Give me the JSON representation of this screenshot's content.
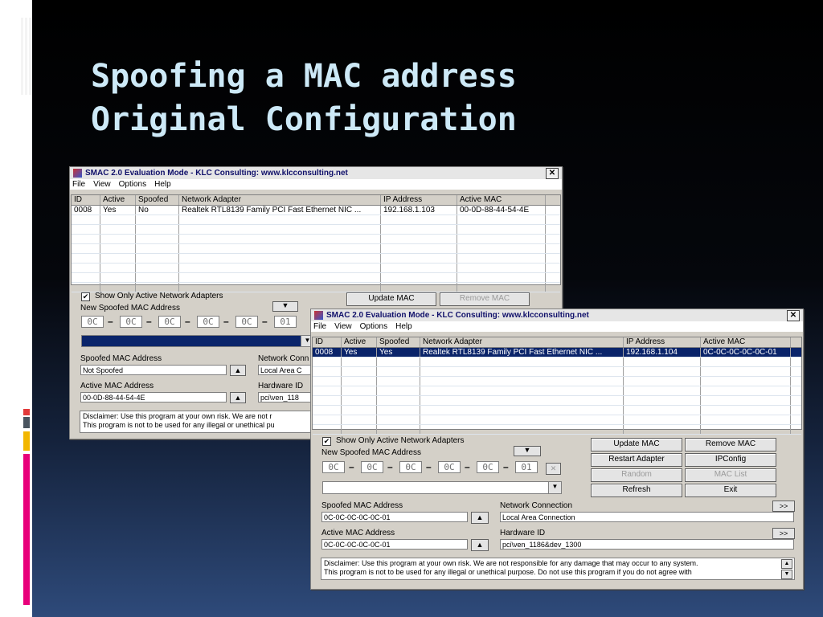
{
  "slide": {
    "title_line1": "Spoofing a MAC address",
    "title_line2": "Original Configuration",
    "colors": {
      "title": "#cde9f7",
      "accent_red": "#e23a3a",
      "accent_gray": "#4a5560",
      "accent_orange": "#f2b600",
      "accent_pink": "#e8007a"
    }
  },
  "window_back": {
    "title": "SMAC 2.0  Evaluation Mode  -  KLC Consulting:  www.klcconsulting.net",
    "menu": [
      "File",
      "View",
      "Options",
      "Help"
    ],
    "columns": [
      "ID",
      "Active",
      "Spoofed",
      "Network Adapter",
      "IP Address",
      "Active MAC"
    ],
    "rows": [
      [
        "0008",
        "Yes",
        "No",
        "Realtek RTL8139 Family PCI Fast Ethernet NIC ...",
        "192.168.1.103",
        "00-0D-88-44-54-4E"
      ]
    ],
    "checkbox_label": "Show Only Active Network Adapters",
    "checkbox_mark": "✔",
    "new_mac_label": "New Spoofed MAC Address",
    "octets": [
      "0C",
      "0C",
      "0C",
      "0C",
      "0C",
      "01"
    ],
    "update_mac": "Update MAC",
    "remove_mac": "Remove MAC",
    "spoofed_label": "Spoofed MAC Address",
    "spoofed_value": "Not Spoofed",
    "active_label": "Active MAC Address",
    "active_value": "00-0D-88-44-54-4E",
    "netconn_label": "Network Conn",
    "netconn_value": "Local Area C",
    "hwid_label": "Hardware ID",
    "hwid_value": "pci\\ven_118",
    "disclaimer_line1": "Disclaimer: Use this program at your own risk.  We are not r",
    "disclaimer_line2": "This program is not to be used for any illegal or unethical pu"
  },
  "window_front": {
    "title": "SMAC 2.0  Evaluation Mode  -  KLC Consulting:  www.klcconsulting.net",
    "menu": [
      "File",
      "View",
      "Options",
      "Help"
    ],
    "columns": [
      "ID",
      "Active",
      "Spoofed",
      "Network Adapter",
      "IP Address",
      "Active MAC"
    ],
    "rows": [
      [
        "0008",
        "Yes",
        "Yes",
        "Realtek RTL8139 Family PCI Fast Ethernet NIC ...",
        "192.168.1.104",
        "0C-0C-0C-0C-0C-01"
      ]
    ],
    "checkbox_label": "Show Only Active Network Adapters",
    "checkbox_mark": "✔",
    "new_mac_label": "New Spoofed MAC Address",
    "octets": [
      "0C",
      "0C",
      "0C",
      "0C",
      "0C",
      "01"
    ],
    "update_mac": "Update MAC",
    "remove_mac": "Remove MAC",
    "restart_adapter": "Restart Adapter",
    "ipconfig": "IPConfig",
    "random": "Random",
    "mac_list": "MAC List",
    "refresh": "Refresh",
    "exit": "Exit",
    "spoofed_label": "Spoofed MAC Address",
    "spoofed_value": "0C-0C-0C-0C-0C-01",
    "active_label": "Active MAC Address",
    "active_value": "0C-0C-0C-0C-0C-01",
    "netconn_label": "Network Connection",
    "netconn_value": "Local Area Connection",
    "hwid_label": "Hardware ID",
    "hwid_value": "pci\\ven_1186&dev_1300",
    "more_button": ">>",
    "disclaimer_line1": "Disclaimer: Use this program at your own risk.  We are not responsible for any damage that may occur to any system.",
    "disclaimer_line2": "This program is not to be used for any illegal or unethical purpose.  Do not use this program if you do not agree with"
  }
}
